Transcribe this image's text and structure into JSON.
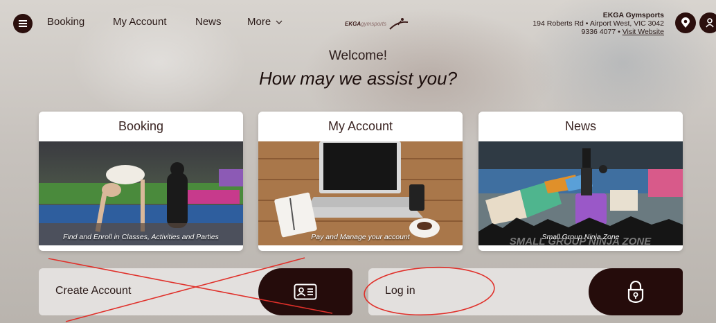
{
  "nav": {
    "links": [
      {
        "label": "Booking"
      },
      {
        "label": "My Account"
      },
      {
        "label": "News"
      },
      {
        "label": "More"
      }
    ],
    "more_chevron": "chevron-down-icon"
  },
  "logo": {
    "bold": "EKGA",
    "light": "gymsports"
  },
  "store": {
    "name": "EKGA Gymsports",
    "address": "194 Roberts Rd • Airport West, VIC 3042",
    "phone": "9336 4077 •",
    "website_link": "Visit Website"
  },
  "hero": {
    "welcome": "Welcome!",
    "assist": "How may we assist you?"
  },
  "cards": [
    {
      "title": "Booking",
      "caption": "Find and Enroll in Classes, Activities and Parties"
    },
    {
      "title": "My Account",
      "caption": "Pay and Manage your account"
    },
    {
      "title": "News",
      "caption": "Small Group Ninja Zone",
      "banner": "SMALL GROUP NINJA ZONE"
    }
  ],
  "actions": {
    "create_account": {
      "label": "Create Account",
      "icon": "id-card-icon"
    },
    "login": {
      "label": "Log in",
      "icon": "lock-icon"
    }
  },
  "colors": {
    "brand_dark": "#250c0b",
    "annotation_red": "#e0302a"
  }
}
